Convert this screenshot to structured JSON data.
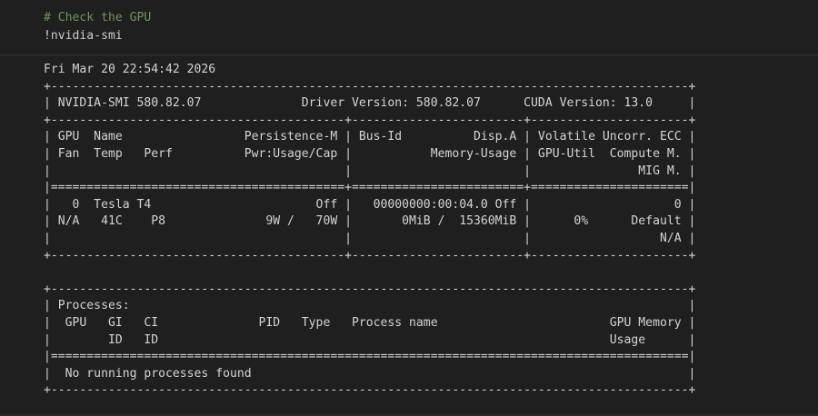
{
  "cell": {
    "code_comment": "# Check the GPU",
    "code_bang": "!",
    "code_command": "nvidia-smi"
  },
  "output": {
    "text": "Fri Mar 20 22:54:42 2026\n+-----------------------------------------------------------------------------------------+\n| NVIDIA-SMI 580.82.07              Driver Version: 580.82.07      CUDA Version: 13.0     |\n+-----------------------------------------+------------------------+----------------------+\n| GPU  Name                 Persistence-M | Bus-Id          Disp.A | Volatile Uncorr. ECC |\n| Fan  Temp   Perf          Pwr:Usage/Cap |           Memory-Usage | GPU-Util  Compute M. |\n|                                         |                        |               MIG M. |\n|=========================================+========================+======================|\n|   0  Tesla T4                       Off |   00000000:00:04.0 Off |                    0 |\n| N/A   41C    P8              9W /   70W |       0MiB /  15360MiB |      0%      Default |\n|                                         |                        |                  N/A |\n+-----------------------------------------+------------------------+----------------------+\n\n+-----------------------------------------------------------------------------------------+\n| Processes:                                                                              |\n|  GPU   GI   CI              PID   Type   Process name                        GPU Memory |\n|        ID   ID                                                               Usage      |\n|=========================================================================================|\n|  No running processes found                                                             |\n+-----------------------------------------------------------------------------------------+"
  }
}
